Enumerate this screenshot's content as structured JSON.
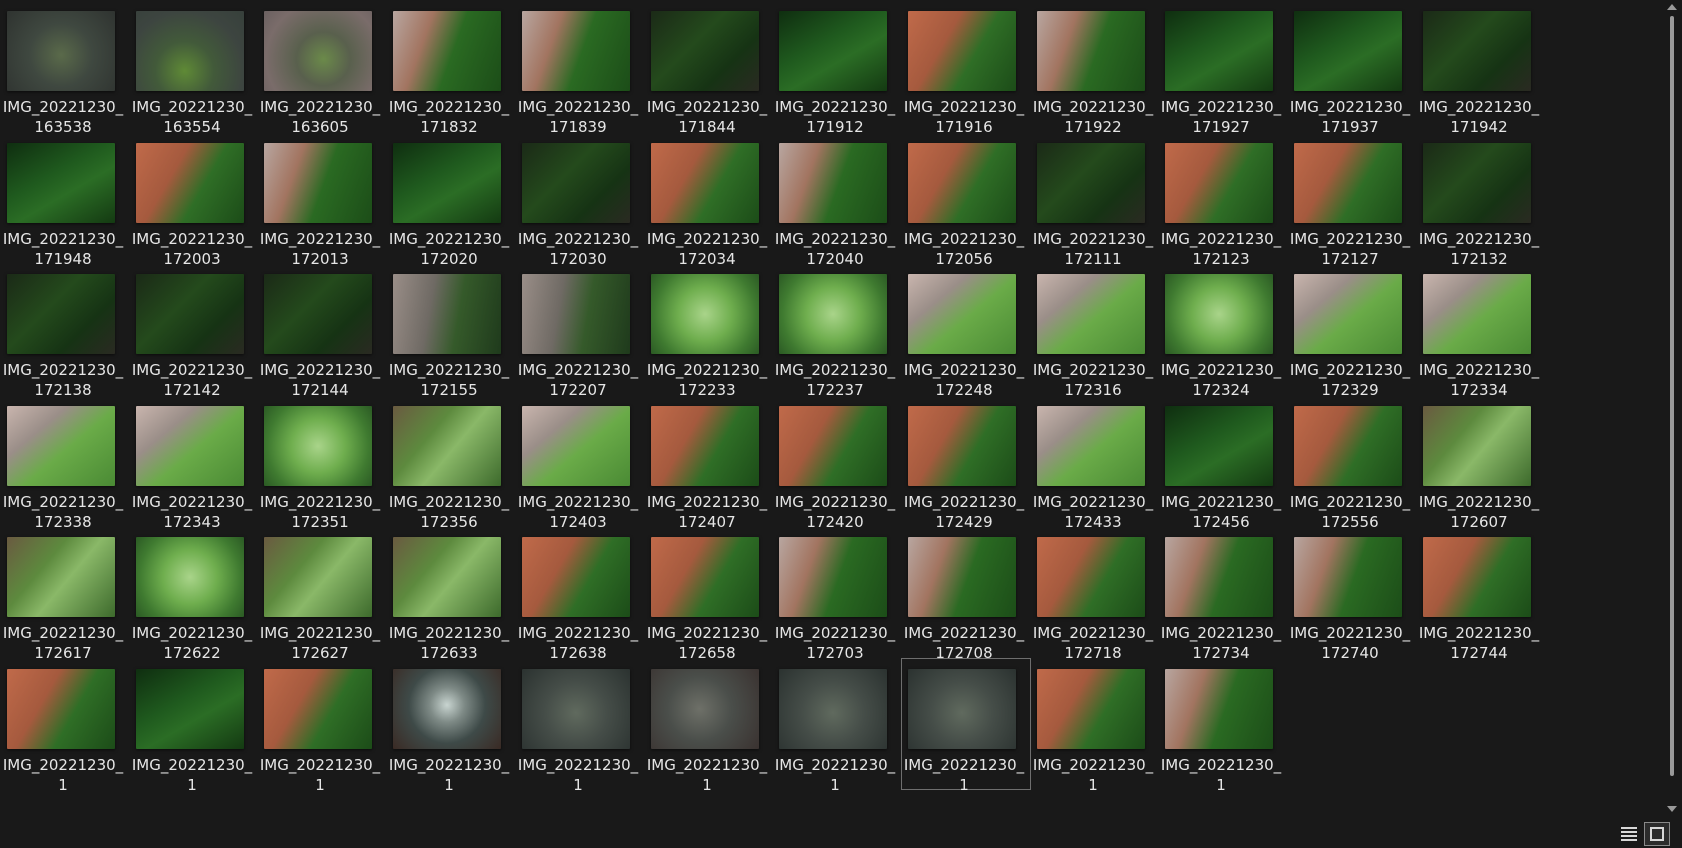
{
  "files": [
    {
      "name": "IMG_20221230_163538",
      "thumb": "blur"
    },
    {
      "name": "IMG_20221230_163554",
      "thumb": "blurg"
    },
    {
      "name": "IMG_20221230_163605",
      "thumb": "blurp"
    },
    {
      "name": "IMG_20221230_171832",
      "thumb": "dish"
    },
    {
      "name": "IMG_20221230_171839",
      "thumb": "dish"
    },
    {
      "name": "IMG_20221230_171844",
      "thumb": "dark"
    },
    {
      "name": "IMG_20221230_171912",
      "thumb": "moss"
    },
    {
      "name": "IMG_20221230_171916",
      "thumb": "orange"
    },
    {
      "name": "IMG_20221230_171922",
      "thumb": "dish"
    },
    {
      "name": "IMG_20221230_171927",
      "thumb": "moss"
    },
    {
      "name": "IMG_20221230_171937",
      "thumb": "moss"
    },
    {
      "name": "IMG_20221230_171942",
      "thumb": "dark"
    },
    {
      "name": "IMG_20221230_171948",
      "thumb": "moss"
    },
    {
      "name": "IMG_20221230_172003",
      "thumb": "orange"
    },
    {
      "name": "IMG_20221230_172013",
      "thumb": "dish"
    },
    {
      "name": "IMG_20221230_172020",
      "thumb": "moss"
    },
    {
      "name": "IMG_20221230_172030",
      "thumb": "dark"
    },
    {
      "name": "IMG_20221230_172034",
      "thumb": "orange"
    },
    {
      "name": "IMG_20221230_172040",
      "thumb": "dish"
    },
    {
      "name": "IMG_20221230_172056",
      "thumb": "orange"
    },
    {
      "name": "IMG_20221230_172111",
      "thumb": "dark"
    },
    {
      "name": "IMG_20221230_172123",
      "thumb": "orange"
    },
    {
      "name": "IMG_20221230_172127",
      "thumb": "orange"
    },
    {
      "name": "IMG_20221230_172132",
      "thumb": "dark"
    },
    {
      "name": "IMG_20221230_172138",
      "thumb": "dark"
    },
    {
      "name": "IMG_20221230_172142",
      "thumb": "dark"
    },
    {
      "name": "IMG_20221230_172144",
      "thumb": "dark"
    },
    {
      "name": "IMG_20221230_172155",
      "thumb": "pale"
    },
    {
      "name": "IMG_20221230_172207",
      "thumb": "pale"
    },
    {
      "name": "IMG_20221230_172233",
      "thumb": "light"
    },
    {
      "name": "IMG_20221230_172237",
      "thumb": "light"
    },
    {
      "name": "IMG_20221230_172248",
      "thumb": "lightd"
    },
    {
      "name": "IMG_20221230_172316",
      "thumb": "lightd"
    },
    {
      "name": "IMG_20221230_172324",
      "thumb": "light"
    },
    {
      "name": "IMG_20221230_172329",
      "thumb": "lightd"
    },
    {
      "name": "IMG_20221230_172334",
      "thumb": "lightd"
    },
    {
      "name": "IMG_20221230_172338",
      "thumb": "lightd"
    },
    {
      "name": "IMG_20221230_172343",
      "thumb": "lightd"
    },
    {
      "name": "IMG_20221230_172351",
      "thumb": "light"
    },
    {
      "name": "IMG_20221230_172356",
      "thumb": "mixed"
    },
    {
      "name": "IMG_20221230_172403",
      "thumb": "lightd"
    },
    {
      "name": "IMG_20221230_172407",
      "thumb": "orange"
    },
    {
      "name": "IMG_20221230_172420",
      "thumb": "orange"
    },
    {
      "name": "IMG_20221230_172429",
      "thumb": "orange"
    },
    {
      "name": "IMG_20221230_172433",
      "thumb": "lightd"
    },
    {
      "name": "IMG_20221230_172456",
      "thumb": "moss"
    },
    {
      "name": "IMG_20221230_172556",
      "thumb": "orange"
    },
    {
      "name": "IMG_20221230_172607",
      "thumb": "mixed"
    },
    {
      "name": "IMG_20221230_172617",
      "thumb": "mixed"
    },
    {
      "name": "IMG_20221230_172622",
      "thumb": "light"
    },
    {
      "name": "IMG_20221230_172627",
      "thumb": "mixed"
    },
    {
      "name": "IMG_20221230_172633",
      "thumb": "mixed"
    },
    {
      "name": "IMG_20221230_172638",
      "thumb": "orange"
    },
    {
      "name": "IMG_20221230_172658",
      "thumb": "orange"
    },
    {
      "name": "IMG_20221230_172703",
      "thumb": "dish"
    },
    {
      "name": "IMG_20221230_172708",
      "thumb": "dish"
    },
    {
      "name": "IMG_20221230_172718",
      "thumb": "orange"
    },
    {
      "name": "IMG_20221230_172734",
      "thumb": "dish"
    },
    {
      "name": "IMG_20221230_172740",
      "thumb": "dish"
    },
    {
      "name": "IMG_20221230_172744",
      "thumb": "orange"
    },
    {
      "name": "IMG_20221230_1",
      "thumb": "orange"
    },
    {
      "name": "IMG_20221230_1",
      "thumb": "moss"
    },
    {
      "name": "IMG_20221230_1",
      "thumb": "orange"
    },
    {
      "name": "IMG_20221230_1",
      "thumb": "glass"
    },
    {
      "name": "IMG_20221230_1",
      "thumb": "gray"
    },
    {
      "name": "IMG_20221230_1",
      "thumb": "grayd"
    },
    {
      "name": "IMG_20221230_1",
      "thumb": "gray"
    },
    {
      "name": "IMG_20221230_1",
      "thumb": "gray",
      "selected": true
    },
    {
      "name": "IMG_20221230_1",
      "thumb": "orange"
    },
    {
      "name": "IMG_20221230_1",
      "thumb": "dish"
    }
  ],
  "view": {
    "details_label": "Details",
    "thumbnails_label": "Large icons",
    "active": "thumbnails"
  }
}
